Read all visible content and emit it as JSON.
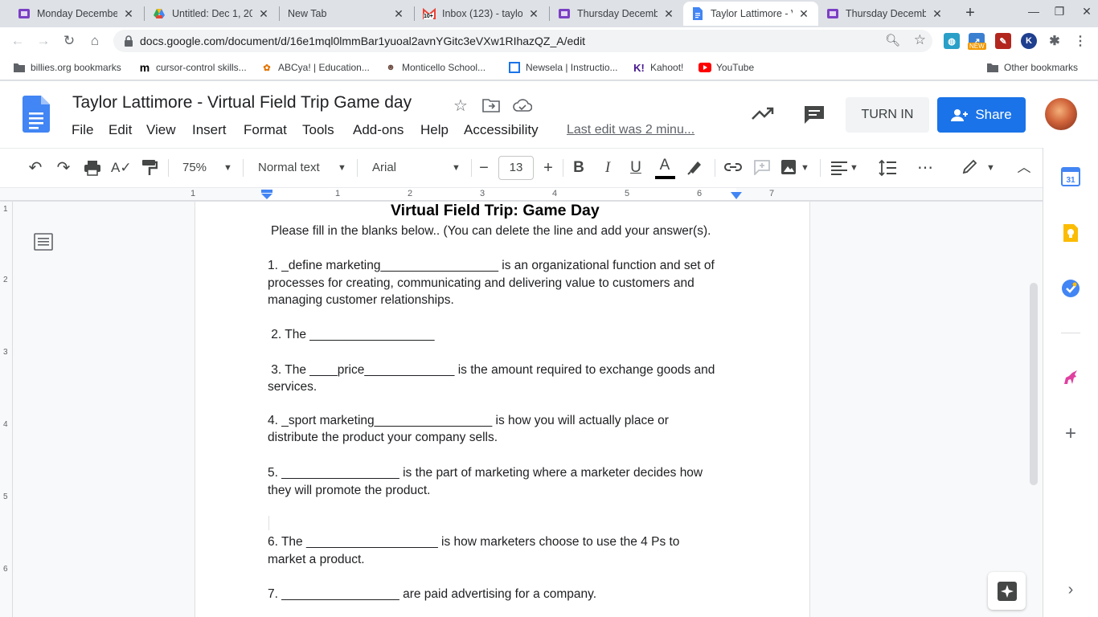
{
  "browser": {
    "tabs": [
      {
        "title": "Monday December",
        "favicon": "purple-doc-icon",
        "active": false
      },
      {
        "title": "Untitled: Dec 1, 202",
        "favicon": "google-drive-icon",
        "active": false
      },
      {
        "title": "New Tab",
        "favicon": "none",
        "active": false
      },
      {
        "title": "Inbox (123) - taylor",
        "favicon": "gmail-icon",
        "active": false
      },
      {
        "title": "Thursday Decembe",
        "favicon": "purple-doc-icon",
        "active": false
      },
      {
        "title": "Taylor Lattimore - V",
        "favicon": "docs-icon",
        "active": true
      },
      {
        "title": "Thursday Decembe",
        "favicon": "purple-doc-icon",
        "active": false
      }
    ],
    "url": "docs.google.com/document/d/16e1mql0lmmBar1yuoal2avnYGitc3eVXw1RIhazQZ_A/edit",
    "gmail_badge": "10+",
    "ext_new_badge": "NEW"
  },
  "bookmarks": [
    {
      "label": "billies.org bookmarks",
      "icon": "folder-icon"
    },
    {
      "label": "cursor-control skills...",
      "icon": "m-icon"
    },
    {
      "label": "ABCya! | Education...",
      "icon": "abcya-icon"
    },
    {
      "label": "Monticello School...",
      "icon": "school-icon"
    },
    {
      "label": "Newsela | Instructio...",
      "icon": "newsela-icon"
    },
    {
      "label": "Kahoot!",
      "icon": "kahoot-icon"
    },
    {
      "label": "YouTube",
      "icon": "youtube-icon"
    },
    {
      "label": "Other bookmarks",
      "icon": "folder-icon"
    }
  ],
  "docs": {
    "title": "Taylor Lattimore - Virtual Field Trip Game day",
    "menu": [
      "File",
      "Edit",
      "View",
      "Insert",
      "Format",
      "Tools",
      "Add-ons",
      "Help",
      "Accessibility"
    ],
    "last_edit": "Last edit was 2 minu...",
    "turn_in_label": "TURN IN",
    "share_label": "Share",
    "toolbar": {
      "zoom": "75%",
      "style": "Normal text",
      "font": "Arial",
      "font_size": "13",
      "minus": "−",
      "plus": "+"
    },
    "ruler_numbers": [
      "1",
      "1",
      "2",
      "3",
      "4",
      "5",
      "6",
      "7"
    ],
    "vruler_numbers": [
      "1",
      "2",
      "3",
      "4",
      "5",
      "6"
    ]
  },
  "document": {
    "heading": "Virtual Field Trip: Game Day",
    "instructions": "Please fill in the blanks below.. (You can delete the line and add your answer(s).",
    "lines": [
      "1. _define marketing_________________ is an organizational function and set of",
      "processes for creating, communicating and delivering value to customers and",
      "managing customer relationships.",
      " 2. The __________________",
      " 3. The ____price_____________ is the amount required to exchange goods and",
      "services.",
      "4. _sport marketing_________________ is how you will actually place or",
      "distribute the product your company sells.",
      "5. _________________ is the part of marketing where a marketer decides how",
      "they will promote the product.",
      "6. The ___________________ is how marketers choose to use the 4 Ps to",
      "market a product.",
      "7. _________________ are paid advertising for a company."
    ]
  },
  "colors": {
    "share_blue": "#1a73e8",
    "docs_blue": "#4285f4",
    "chrome_bg": "#dee1e6"
  }
}
